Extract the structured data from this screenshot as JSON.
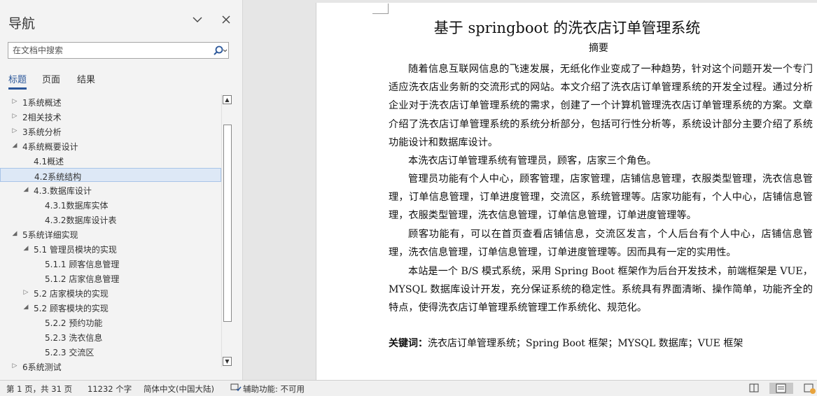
{
  "nav": {
    "title": "导航",
    "search_placeholder": "在文档中搜索",
    "tabs": [
      {
        "label": "标题"
      },
      {
        "label": "页面"
      },
      {
        "label": "结果"
      }
    ],
    "tree": [
      {
        "label": "1系统概述",
        "level": 0,
        "expanded": false
      },
      {
        "label": "2相关技术",
        "level": 0,
        "expanded": false
      },
      {
        "label": "3系统分析",
        "level": 0,
        "expanded": false
      },
      {
        "label": "4系统概要设计",
        "level": 0,
        "expanded": true
      },
      {
        "label": "4.1概述",
        "level": 1,
        "leaf": true
      },
      {
        "label": "4.2系统结构",
        "level": 1,
        "leaf": true,
        "selected": true
      },
      {
        "label": "4.3.数据库设计",
        "level": 1,
        "expanded": true
      },
      {
        "label": "4.3.1数据库实体",
        "level": 2,
        "leaf": true
      },
      {
        "label": "4.3.2数据库设计表",
        "level": 2,
        "leaf": true
      },
      {
        "label": "5系统详细实现",
        "level": 0,
        "expanded": true
      },
      {
        "label": "5.1 管理员模块的实现",
        "level": 1,
        "expanded": true
      },
      {
        "label": "5.1.1 顾客信息管理",
        "level": 2,
        "leaf": true
      },
      {
        "label": "5.1.2 店家信息管理",
        "level": 2,
        "leaf": true
      },
      {
        "label": "5.2 店家模块的实现",
        "level": 1,
        "expanded": false
      },
      {
        "label": "5.2 顾客模块的实现",
        "level": 1,
        "expanded": true
      },
      {
        "label": "5.2.2 预约功能",
        "level": 2,
        "leaf": true
      },
      {
        "label": "5.2.3 洗衣信息",
        "level": 2,
        "leaf": true
      },
      {
        "label": "5.2.3 交流区",
        "level": 2,
        "leaf": true
      },
      {
        "label": "6系统测试",
        "level": 0,
        "expanded": false
      }
    ]
  },
  "document": {
    "title": "基于 springboot 的洗衣店订单管理系统",
    "abstract_heading": "摘要",
    "paragraphs": [
      "随着信息互联网信息的飞速发展，无纸化作业变成了一种趋势，针对这个问题开发一个专门适应洗衣店业务新的交流形式的网站。本文介绍了洗衣店订单管理系统的开发全过程。通过分析企业对于洗衣店订单管理系统的需求，创建了一个计算机管理洗衣店订单管理系统的方案。文章介绍了洗衣店订单管理系统的系统分析部分，包括可行性分析等，系统设计部分主要介绍了系统功能设计和数据库设计。",
      "本洗衣店订单管理系统有管理员，顾客，店家三个角色。",
      "管理员功能有个人中心，顾客管理，店家管理，店铺信息管理，衣服类型管理，洗衣信息管理，订单信息管理，订单进度管理，交流区，系统管理等。店家功能有，个人中心，店铺信息管理，衣服类型管理，洗衣信息管理，订单信息管理，订单进度管理等。",
      "顾客功能有，可以在首页查看店铺信息，交流区发言，个人后台有个人中心，店铺信息管理，洗衣信息管理，订单信息管理，订单进度管理等。因而具有一定的实用性。",
      "本站是一个 B/S 模式系统，采用 Spring Boot 框架作为后台开发技术，前端框架是 VUE，MYSQL 数据库设计开发，充分保证系统的稳定性。系统具有界面清晰、操作简单，功能齐全的特点，使得洗衣店订单管理系统管理工作系统化、规范化。"
    ],
    "keywords_label": "关键词：",
    "keywords_text": "洗衣店订单管理系统；Spring Boot 框架；MYSQL 数据库；VUE 框架"
  },
  "status": {
    "page_info": "第 1 页，共 31 页",
    "word_count": "11232 个字",
    "language": "简体中文(中国大陆)",
    "accessibility": "辅助功能: 不可用"
  }
}
